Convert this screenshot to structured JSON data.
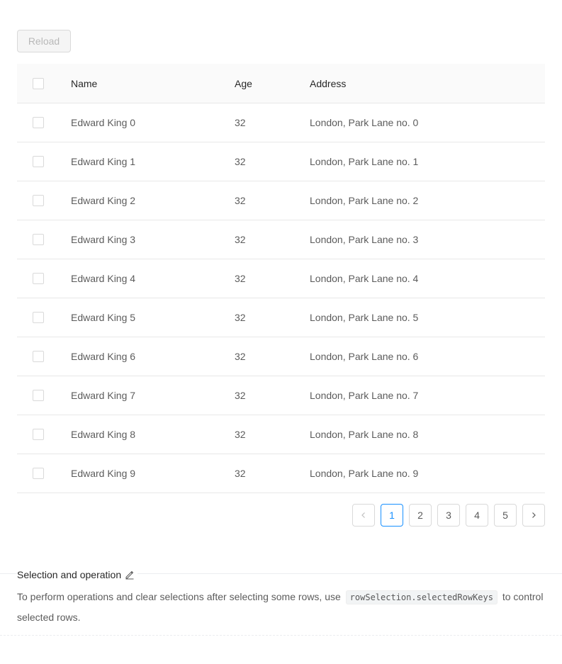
{
  "toolbar": {
    "reload_label": "Reload",
    "reload_disabled": true
  },
  "table": {
    "columns": [
      "Name",
      "Age",
      "Address"
    ],
    "rows": [
      {
        "name": "Edward King 0",
        "age": "32",
        "address": "London, Park Lane no. 0"
      },
      {
        "name": "Edward King 1",
        "age": "32",
        "address": "London, Park Lane no. 1"
      },
      {
        "name": "Edward King 2",
        "age": "32",
        "address": "London, Park Lane no. 2"
      },
      {
        "name": "Edward King 3",
        "age": "32",
        "address": "London, Park Lane no. 3"
      },
      {
        "name": "Edward King 4",
        "age": "32",
        "address": "London, Park Lane no. 4"
      },
      {
        "name": "Edward King 5",
        "age": "32",
        "address": "London, Park Lane no. 5"
      },
      {
        "name": "Edward King 6",
        "age": "32",
        "address": "London, Park Lane no. 6"
      },
      {
        "name": "Edward King 7",
        "age": "32",
        "address": "London, Park Lane no. 7"
      },
      {
        "name": "Edward King 8",
        "age": "32",
        "address": "London, Park Lane no. 8"
      },
      {
        "name": "Edward King 9",
        "age": "32",
        "address": "London, Park Lane no. 9"
      }
    ]
  },
  "pagination": {
    "pages": [
      "1",
      "2",
      "3",
      "4",
      "5"
    ],
    "current": "1",
    "prev_icon": "chevron-left-icon",
    "next_icon": "chevron-right-icon"
  },
  "section": {
    "title": "Selection and operation",
    "edit_icon": "edit-icon",
    "desc_before": "To perform operations and clear selections after selecting some rows, use",
    "code": "rowSelection.selectedRowKeys",
    "desc_after": "to control selected rows."
  },
  "colors": {
    "primary": "#1890ff",
    "border": "#d9d9d9",
    "header_bg": "#fafafa",
    "row_border": "#e8e8e8"
  }
}
